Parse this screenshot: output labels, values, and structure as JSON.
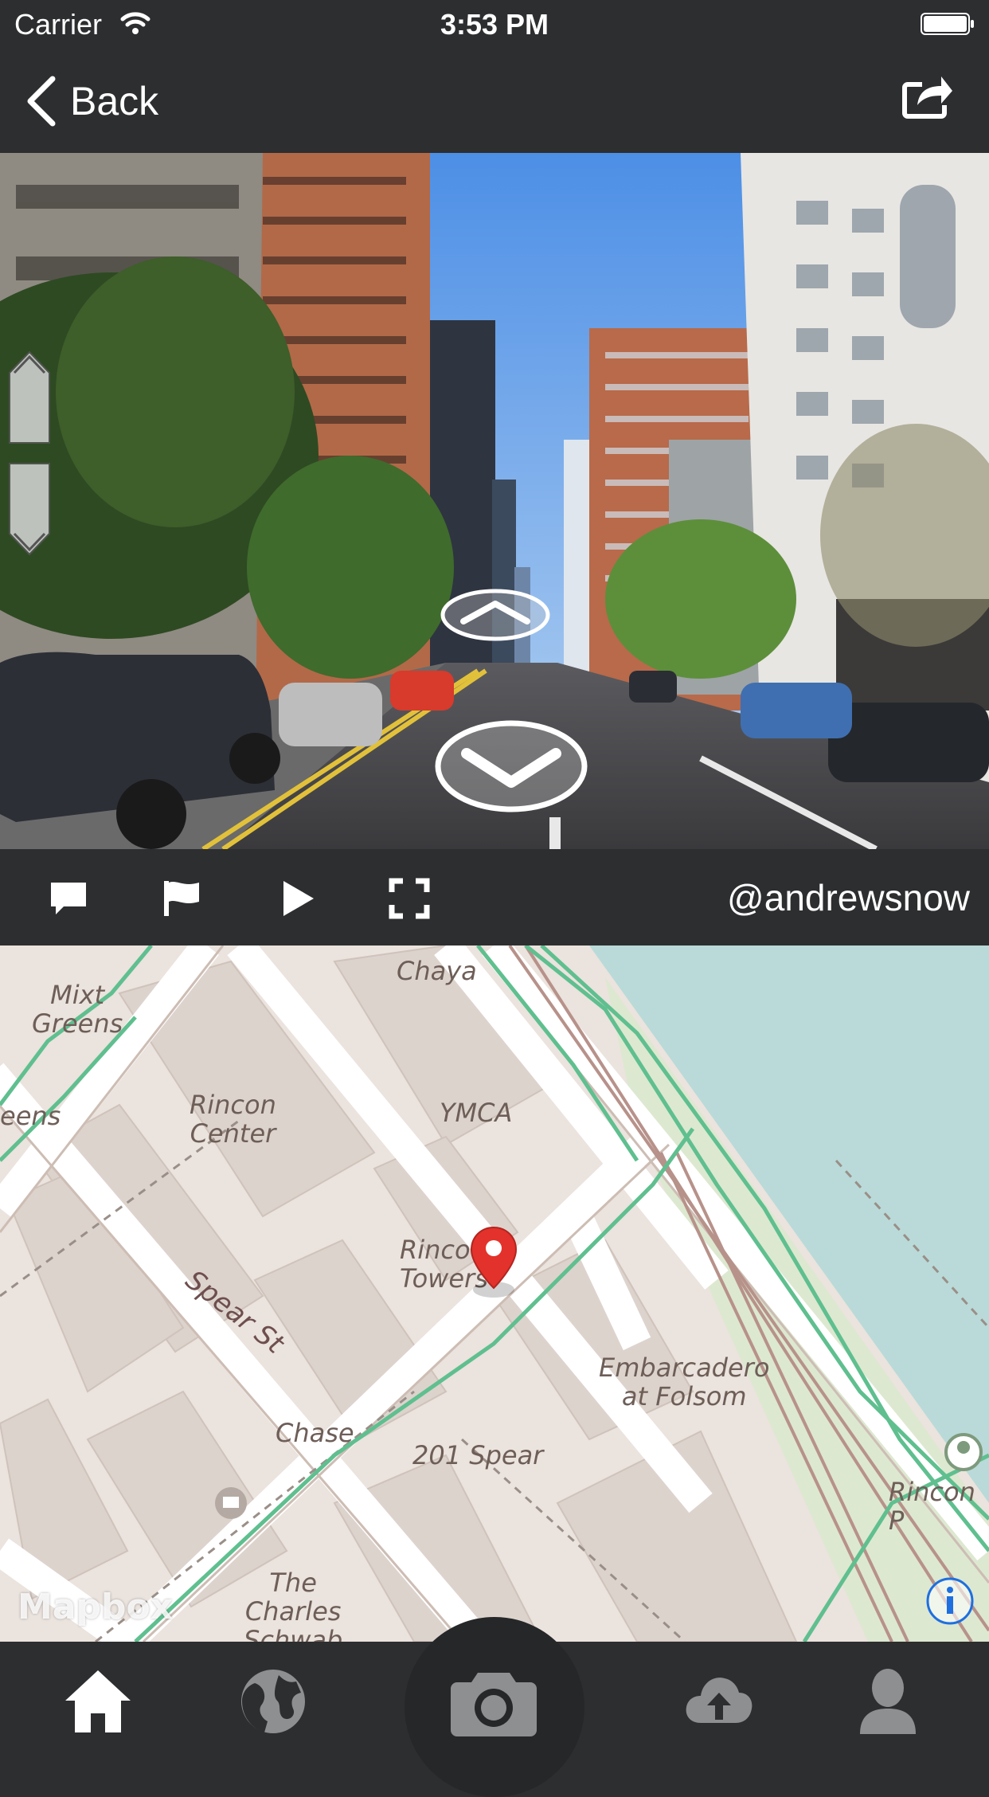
{
  "status_bar": {
    "carrier": "Carrier",
    "time": "3:53 PM"
  },
  "nav": {
    "back_label": "Back",
    "share_icon": "share-icon"
  },
  "photo_controls": {
    "pitch_up_icon": "chevron-up-icon",
    "pitch_down_icon": "chevron-down-icon",
    "move_forward_icon": "chevron-up-icon",
    "move_back_icon": "chevron-down-icon"
  },
  "toolbar": {
    "icons": [
      "comment-icon",
      "flag-icon",
      "play-icon",
      "fullscreen-icon"
    ],
    "username": "@andrewsnow"
  },
  "map": {
    "labels": {
      "mixt_greens_line1": "Mixt",
      "mixt_greens_line2": "Greens",
      "chaya": "Chaya",
      "greens_cut": "eens",
      "rincon_center_line1": "Rincon",
      "rincon_center_line2": "Center",
      "ymca": "YMCA",
      "rincon_tower_line1": "Rinco",
      "rincon_tower_line2": "Towers",
      "spear_st": "Spear St",
      "embarcadero_line1": "Embarcadero",
      "embarcadero_line2": "at Folsom",
      "chase": "Chase",
      "spear_201": "201 Spear",
      "rincon_park": "Rincon P",
      "charles_line1": "The",
      "charles_line2": "Charles",
      "charles_line3": "Schwab"
    },
    "attribution": "Mapbox",
    "water_color": "#b9dad8",
    "land_color": "#ebe3dd",
    "route_color": "#5fbf8f",
    "pin_color": "#e3322b"
  },
  "tabbar": {
    "tabs": [
      "home-icon",
      "globe-icon",
      "camera-icon",
      "cloud-upload-icon",
      "profile-icon"
    ]
  },
  "colors": {
    "bar_background": "#2d2e30",
    "icon_white": "#ffffff",
    "tab_icon_gray": "#8e8f91"
  }
}
